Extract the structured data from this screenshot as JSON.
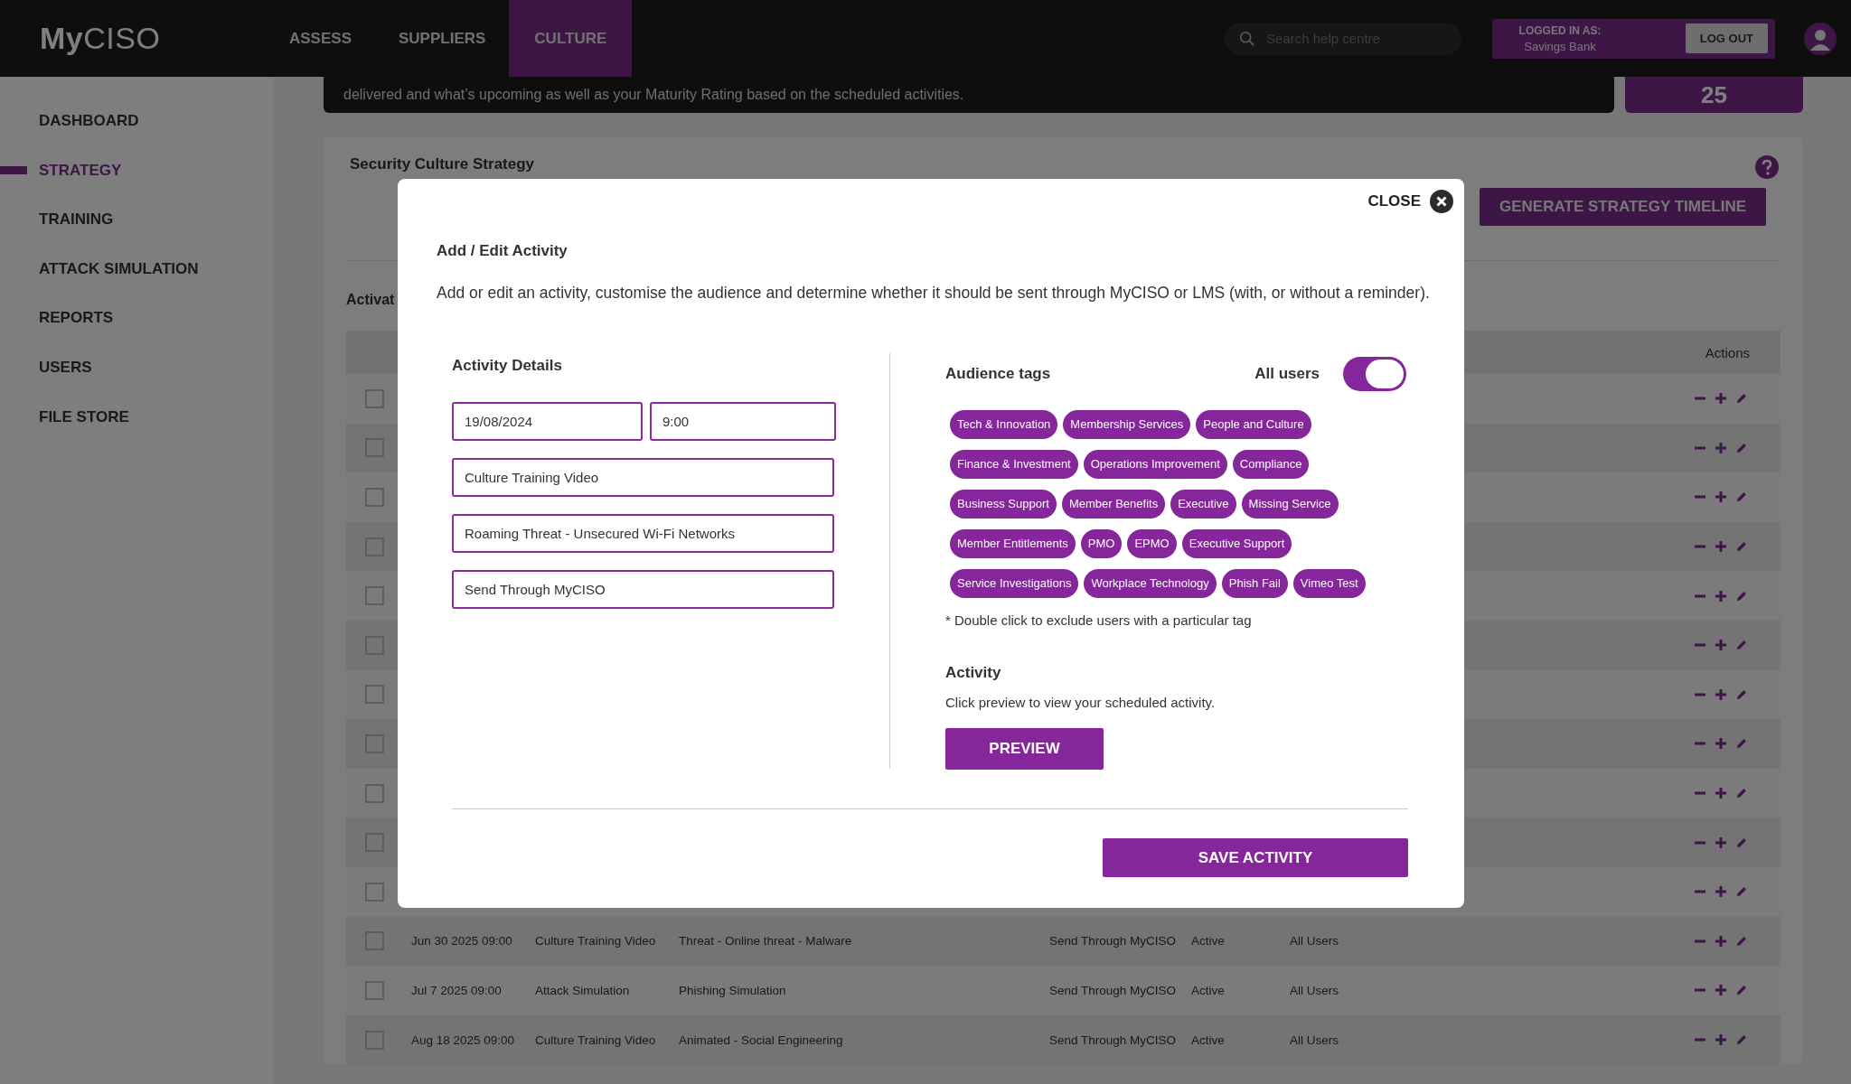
{
  "top_bar": {
    "logo": "**My**CISO",
    "nav": [
      {
        "label": "ASSESS",
        "selected": false
      },
      {
        "label": "SUPPLIERS",
        "selected": false
      },
      {
        "label": "CULTURE",
        "selected": true
      }
    ],
    "search": {
      "placeholder": "Search help centre"
    },
    "account": {
      "caption": "LOGGED IN AS:",
      "name": "Savings Bank",
      "logout": "LOG OUT"
    }
  },
  "sidebar": {
    "items": [
      {
        "label": "DASHBOARD",
        "selected": false
      },
      {
        "label": "STRATEGY",
        "selected": true
      },
      {
        "label": "TRAINING",
        "selected": false
      },
      {
        "label": "ATTACK SIMULATION",
        "selected": false
      },
      {
        "label": "REPORTS",
        "selected": false
      },
      {
        "label": "USERS",
        "selected": false
      },
      {
        "label": "FILE STORE",
        "selected": false
      }
    ]
  },
  "banner": {
    "text": "delivered and what’s upcoming as well as your Maturity Rating based on the scheduled activities.",
    "score": "25"
  },
  "strategy": {
    "title": "Security Culture Strategy",
    "generate_button": "GENERATE STRATEGY TIMELINE",
    "section_title": "Activat",
    "table": {
      "columns": [
        "Actions"
      ],
      "rows": [
        {
          "checked": false
        },
        {
          "checked": false
        },
        {
          "checked": false
        },
        {
          "checked": false
        },
        {
          "checked": false
        },
        {
          "checked": false
        },
        {
          "checked": false
        },
        {
          "checked": false
        },
        {
          "checked": false
        },
        {
          "checked": false
        },
        {
          "checked": false
        },
        {
          "checked": false,
          "cells": [
            "Jun 30 2025 09:00",
            "Culture Training Video",
            "Threat - Online threat - Malware",
            "Send Through MyCISO",
            "Active",
            "All Users"
          ]
        },
        {
          "checked": false,
          "cells": [
            "Jul 7 2025 09:00",
            "Attack Simulation",
            "Phishing Simulation",
            "Send Through MyCISO",
            "Active",
            "All Users"
          ]
        },
        {
          "checked": false,
          "cells": [
            "Aug 18 2025 09:00",
            "Culture Training Video",
            "Animated - Social Engineering",
            "Send Through MyCISO",
            "Active",
            "All Users"
          ]
        }
      ]
    }
  },
  "modal": {
    "close": "CLOSE",
    "title": "Add / Edit Activity",
    "description": "Add or edit an activity, customise the audience and determine whether it should be sent through MyCISO or LMS (with, or without a reminder).",
    "details": {
      "heading": "Activity Details",
      "date": "19/08/2024",
      "time": "9:00",
      "type": "Culture Training Video",
      "activity": "Roaming Threat - Unsecured Wi-Fi Networks",
      "delivery": "Send Through MyCISO"
    },
    "audience": {
      "heading": "Audience tags",
      "all_users": {
        "label": "All users",
        "on": true
      },
      "tags": [
        [
          "Tech & Innovation",
          "Membership Services",
          "People and Culture"
        ],
        [
          "Finance & Investment",
          "Operations Improvement",
          "Compliance"
        ],
        [
          "Business Support",
          "Member Benefits",
          "Executive",
          "Missing Service"
        ],
        [
          "Member Entitlements",
          "PMO",
          "EPMO",
          "Executive Support"
        ],
        [
          "Service Investigations",
          "Workplace Technology",
          "Phish Fail",
          "Vimeo Test"
        ]
      ],
      "note": "* Double click to exclude users with a particular tag"
    },
    "activity": {
      "heading": "Activity",
      "text": "Click preview to view your scheduled activity.",
      "preview": "PREVIEW"
    },
    "save": "SAVE ACTIVITY"
  }
}
